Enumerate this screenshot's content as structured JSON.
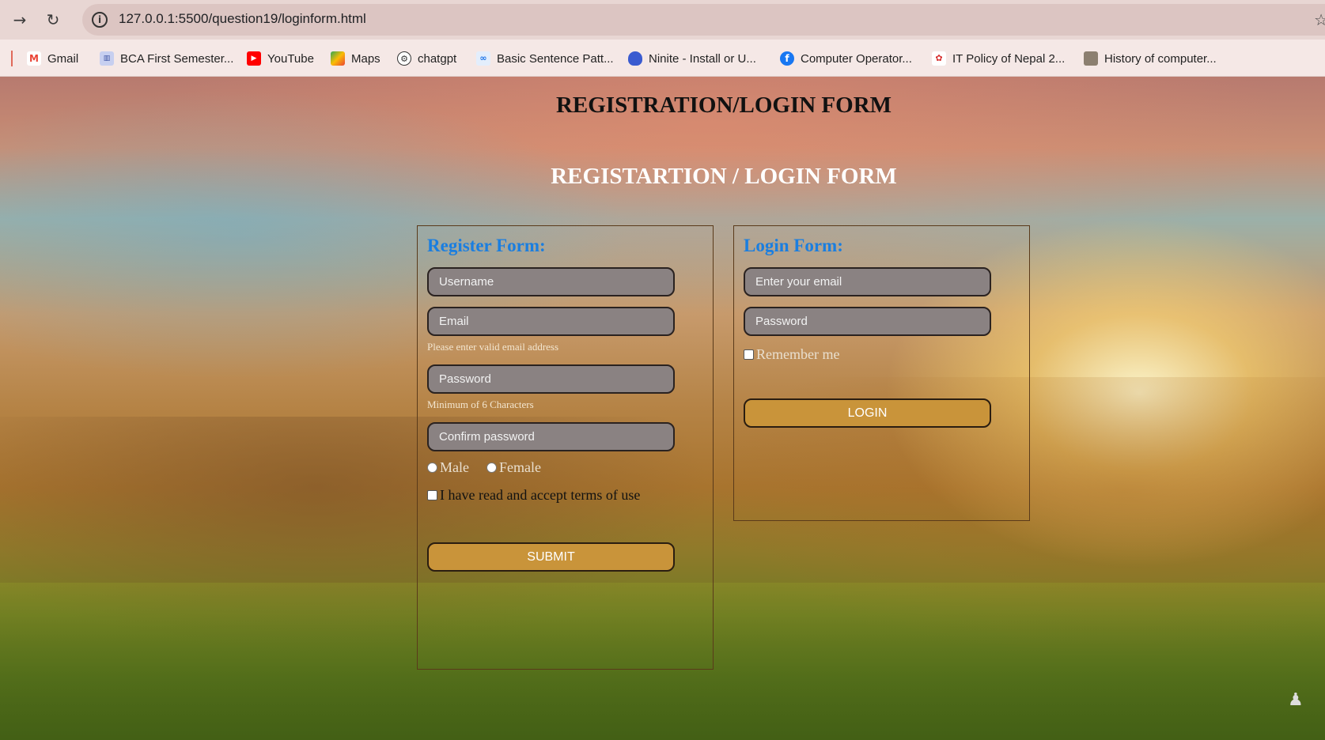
{
  "browser": {
    "url": "127.0.0.1:5500/question19/loginform.html",
    "icons": [
      "forward-icon",
      "reload-icon",
      "info-icon",
      "star-icon"
    ],
    "bookmarks": [
      {
        "label": "Gmail",
        "icon": "gmail-icon",
        "color": "#ea4335"
      },
      {
        "label": "BCA First Semester...",
        "icon": "bca-icon",
        "color": "#6a7fd0"
      },
      {
        "label": "YouTube",
        "icon": "youtube-icon",
        "color": "#ff0000"
      },
      {
        "label": "Maps",
        "icon": "maps-icon",
        "color": "#34a853"
      },
      {
        "label": "chatgpt",
        "icon": "chatgpt-icon",
        "color": "#333333"
      },
      {
        "label": "Basic Sentence Patt...",
        "icon": "basic-sentence-icon",
        "color": "#1a73e8"
      },
      {
        "label": "Ninite - Install or U...",
        "icon": "ninite-icon",
        "color": "#3a5bd0"
      },
      {
        "label": "Computer Operator...",
        "icon": "facebook-icon",
        "color": "#1877f2"
      },
      {
        "label": "IT Policy of Nepal 2...",
        "icon": "it-policy-icon",
        "color": "#d62b2b"
      },
      {
        "label": "History of computer...",
        "icon": "history-icon",
        "color": "#7a6a5a"
      }
    ]
  },
  "page": {
    "main_title": "REGISTRATION/LOGIN FORM",
    "sub_title": "REGISTARTION / LOGIN FORM"
  },
  "register": {
    "heading": "Register Form:",
    "username_placeholder": "Username",
    "email_placeholder": "Email",
    "email_hint": "Please enter valid email address",
    "password_placeholder": "Password",
    "password_hint": "Minimum of 6 Characters",
    "confirm_placeholder": "Confirm password",
    "gender_male": "Male",
    "gender_female": "Female",
    "terms": "I have read and accept terms of use",
    "submit": "SUBMIT"
  },
  "login": {
    "heading": "Login Form:",
    "email_placeholder": "Enter your email",
    "password_placeholder": "Password",
    "remember": "Remember me",
    "button": "LOGIN"
  }
}
